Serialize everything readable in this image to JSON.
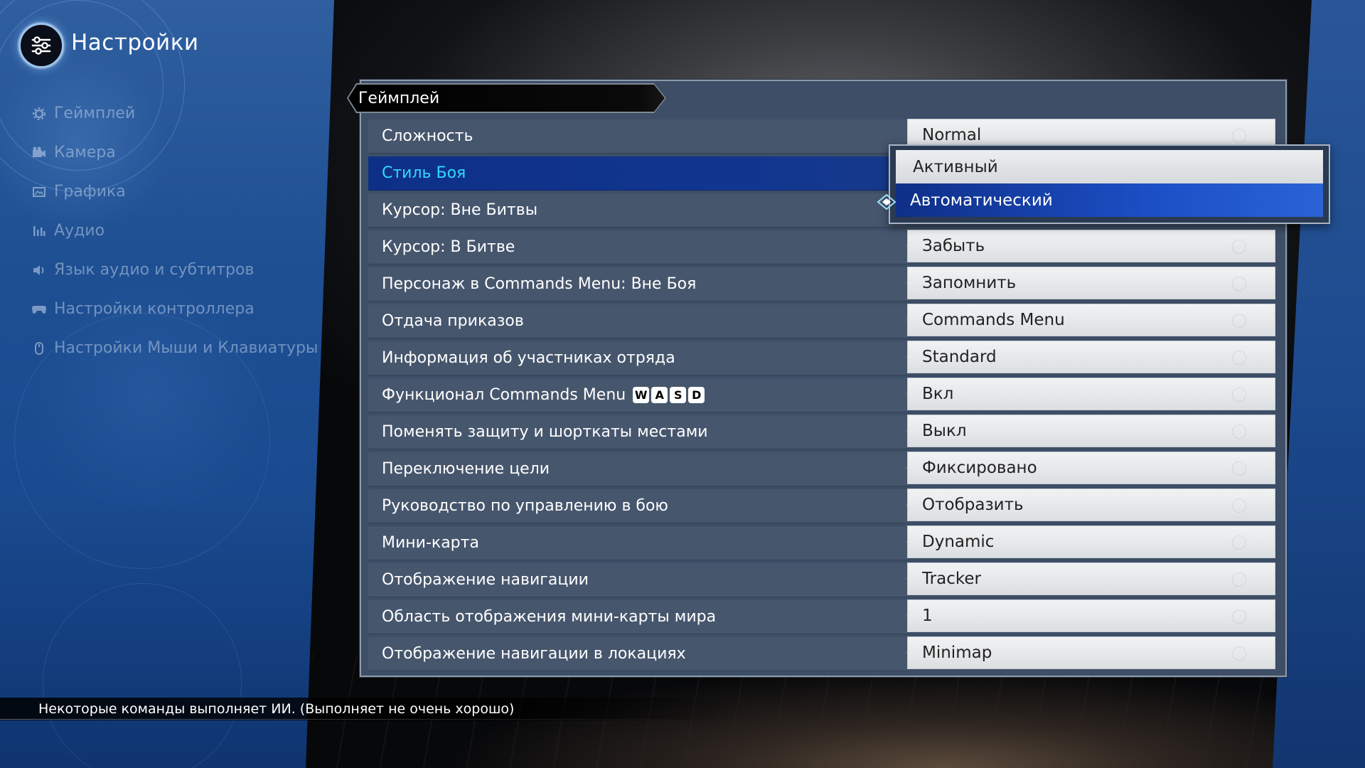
{
  "app": {
    "title": "Настройки"
  },
  "sidebar": {
    "items": [
      {
        "label": "Геймплей",
        "icon": "gear-icon"
      },
      {
        "label": "Камера",
        "icon": "camera-icon"
      },
      {
        "label": "Графика",
        "icon": "image-icon"
      },
      {
        "label": "Аудио",
        "icon": "audio-bars-icon"
      },
      {
        "label": "Язык аудио и субтитров",
        "icon": "speaker-icon"
      },
      {
        "label": "Настройки контроллера",
        "icon": "gamepad-icon"
      },
      {
        "label": "Настройки Мыши и Клавиатуры",
        "icon": "mouse-icon"
      }
    ]
  },
  "panel": {
    "header": "Геймплей"
  },
  "settings": [
    {
      "label": "Сложность",
      "value": "Normal"
    },
    {
      "label": "Стиль Боя",
      "value": ""
    },
    {
      "label": "Курсор: Вне Битвы",
      "value": ""
    },
    {
      "label": "Курсор: В Битве",
      "value": "Забыть"
    },
    {
      "label": "Персонаж в Commands Menu: Вне Боя",
      "value": "Запомнить"
    },
    {
      "label": "Отдача приказов",
      "value": "Commands Menu"
    },
    {
      "label": "Информация об участниках отряда",
      "value": "Standard"
    },
    {
      "label": "Функционал Commands Menu",
      "value": "Вкл",
      "keys": [
        "W",
        "A",
        "S",
        "D"
      ]
    },
    {
      "label": "Поменять защиту и шорткаты местами",
      "value": "Выкл"
    },
    {
      "label": "Переключение цели",
      "value": "Фиксировано"
    },
    {
      "label": "Руководство по управлению в бою",
      "value": "Отобразить"
    },
    {
      "label": "Мини-карта",
      "value": "Dynamic"
    },
    {
      "label": "Отображение навигации",
      "value": "Tracker"
    },
    {
      "label": "Область отображения мини-карты мира",
      "value": "1"
    },
    {
      "label": "Отображение навигации в локациях",
      "value": "Minimap"
    }
  ],
  "dropdown": {
    "options": [
      "Активный",
      "Автоматический"
    ],
    "highlighted": "Автоматический"
  },
  "footer": {
    "description": "Некоторые команды выполняет ИИ. (Выполняет не очень хорошо)"
  },
  "colors": {
    "sidebar_bg": "#1e4f93",
    "selected_label": "#33d8ff",
    "selected_row_bg": "#123690",
    "panel_bg": "#3d4e66",
    "value_bg": "#e6e8ea"
  }
}
